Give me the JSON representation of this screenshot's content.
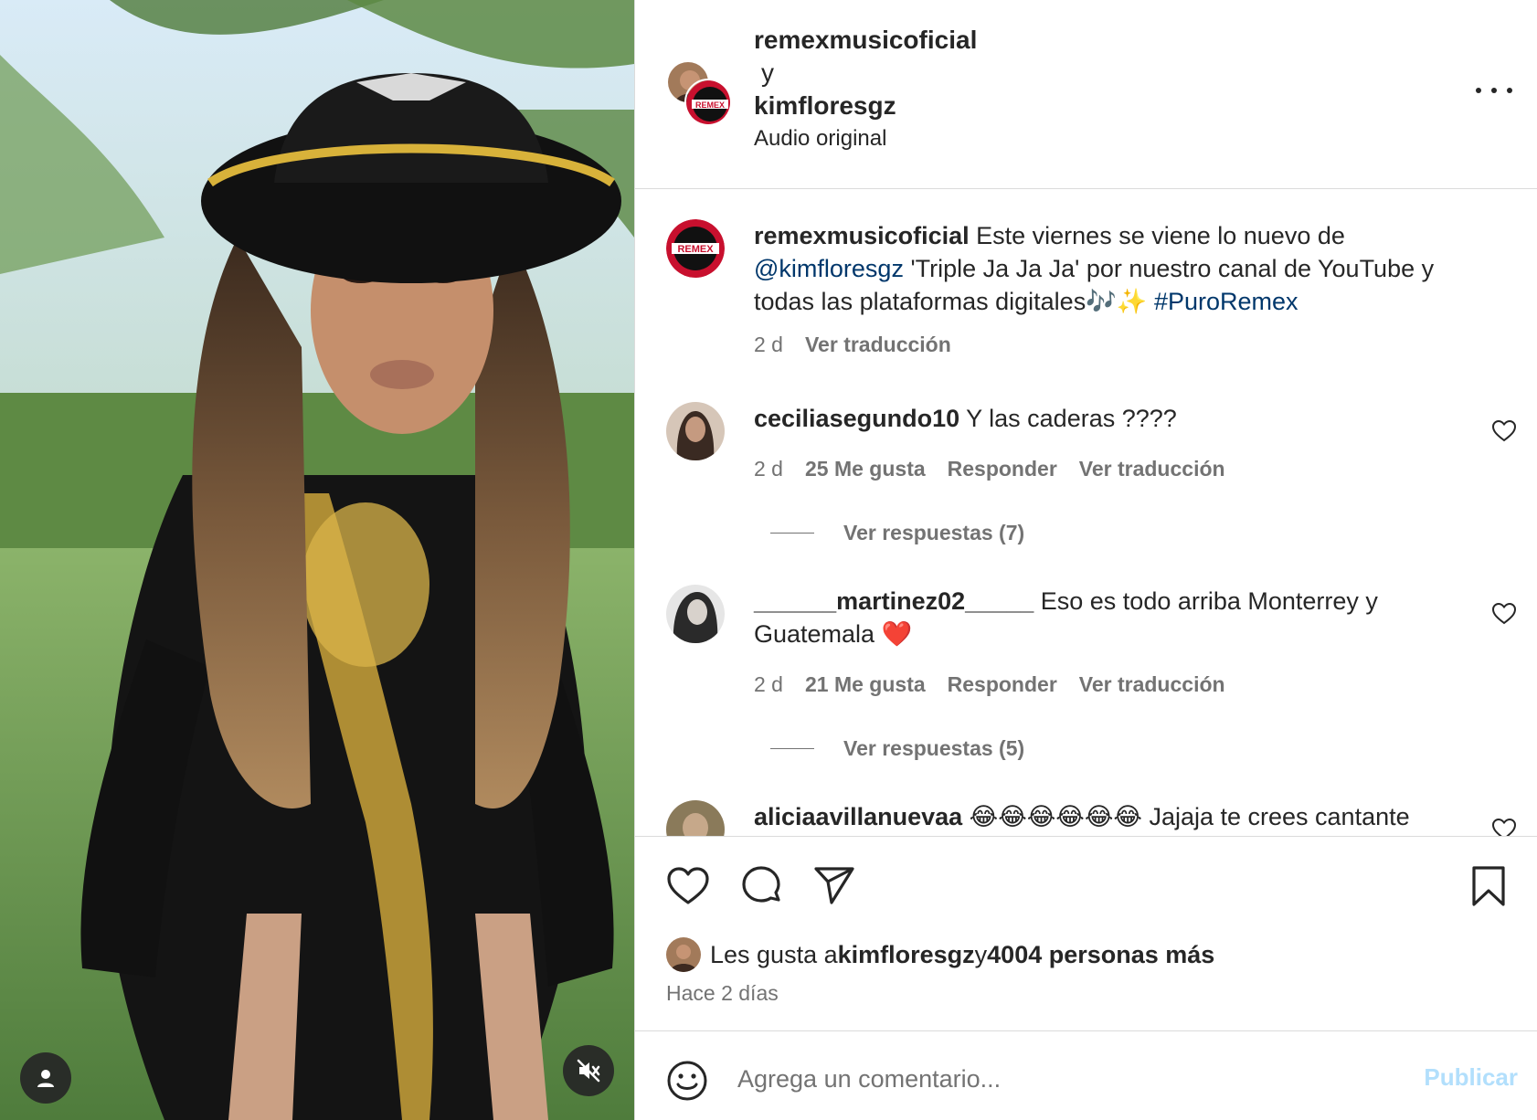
{
  "post": {
    "author": "remexmusicoficial",
    "joiner": "y",
    "coauthor": "kimfloresgz",
    "audio": "Audio original"
  },
  "caption": {
    "username": "remexmusicoficial",
    "text_1": " Este viernes se viene lo nuevo de ",
    "mention": "@kimfloresgz",
    "text_2": " 'Triple Ja Ja Ja' por nuestro canal de YouTube y todas las plataformas digitales🎶✨ ",
    "hashtag": "#PuroRemex",
    "time": "2 d",
    "translate": "Ver traducción"
  },
  "comments": [
    {
      "username": "ceciliasegundo10",
      "text": " Y las caderas ????",
      "time": "2 d",
      "likes": "25 Me gusta",
      "reply": "Responder",
      "translate": "Ver traducción",
      "replies": "Ver respuestas (7)"
    },
    {
      "username": "______martinez02_____",
      "text": " Eso es todo arriba Monterrey y Guatemala ❤️",
      "time": "2 d",
      "likes": "21 Me gusta",
      "reply": "Responder",
      "translate": "Ver traducción",
      "replies": "Ver respuestas (5)"
    },
    {
      "username": "aliciaavillanuevaa",
      "text": " 😂😂😂😂😂😂 Jajaja te crees cantante"
    }
  ],
  "likes": {
    "prefix": "Les gusta a ",
    "user": "kimfloresgz",
    "joiner": " y ",
    "count": "4004 personas más"
  },
  "time_ago": "Hace 2 días",
  "composer": {
    "placeholder": "Agrega un comentario...",
    "publish": "Publicar"
  },
  "colors": {
    "link": "#00376b",
    "secondary_text": "#737373",
    "publish_disabled": "#b2dffc"
  },
  "icons": [
    "more-icon",
    "heart-icon",
    "comment-icon",
    "share-icon",
    "bookmark-icon",
    "emoji-icon",
    "user-icon",
    "mute-icon"
  ]
}
